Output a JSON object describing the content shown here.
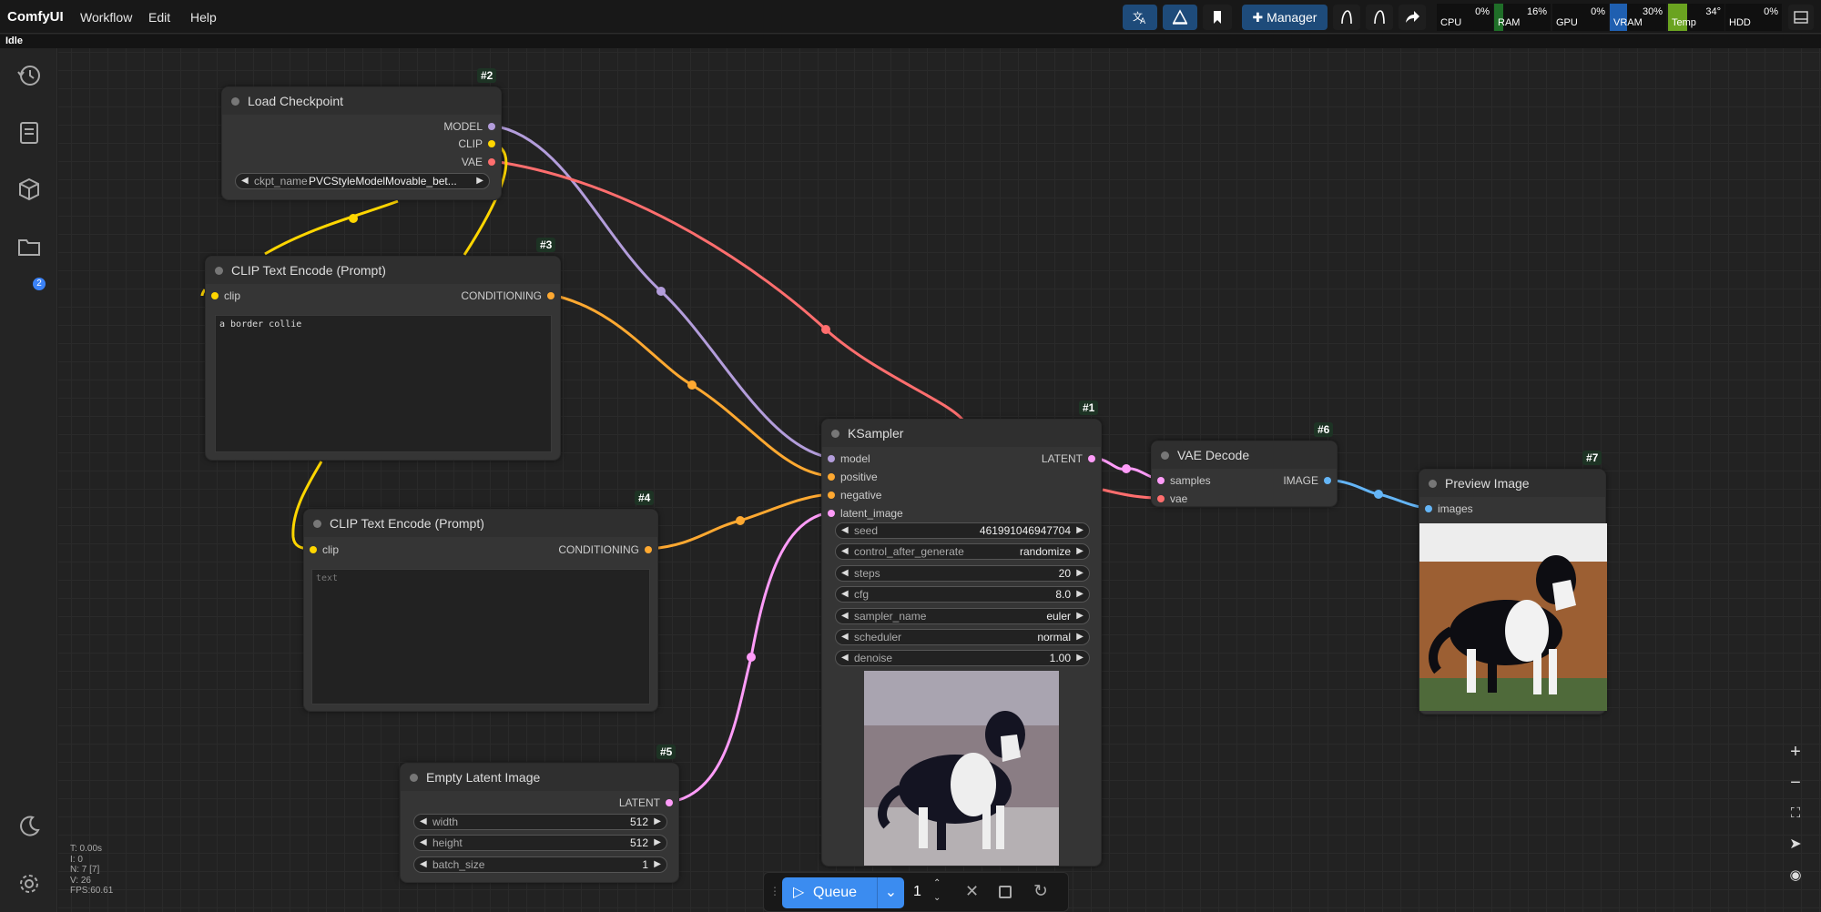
{
  "app": {
    "brand": "ComfyUI",
    "status": "Idle"
  },
  "menu": [
    "Workflow",
    "Edit",
    "Help"
  ],
  "toolbar": {
    "manager_label": "Manager"
  },
  "monitors": [
    {
      "label": "CPU",
      "value": "0%",
      "fill": 0.0,
      "color": "#2f7d32"
    },
    {
      "label": "RAM",
      "value": "16%",
      "fill": 0.16,
      "color": "#1f6e28"
    },
    {
      "label": "GPU",
      "value": "0%",
      "fill": 0.0,
      "color": "#2f7d32"
    },
    {
      "label": "VRAM",
      "value": "30%",
      "fill": 0.3,
      "color": "#1f5fb0"
    },
    {
      "label": "Temp",
      "value": "34°",
      "fill": 0.34,
      "color": "#6aa320"
    },
    {
      "label": "HDD",
      "value": "0%",
      "fill": 0.0,
      "color": "#2f7d32"
    }
  ],
  "sidebar": {
    "queue_badge": "2"
  },
  "nodes": {
    "load_checkpoint": {
      "id": "#2",
      "title": "Load Checkpoint",
      "outputs": [
        "MODEL",
        "CLIP",
        "VAE"
      ],
      "ckpt_label": "ckpt_name",
      "ckpt_value": "PVCStyleModelMovable_bet..."
    },
    "clip_pos": {
      "id": "#3",
      "title": "CLIP Text Encode (Prompt)",
      "input": "clip",
      "output": "CONDITIONING",
      "text": "a border collie"
    },
    "clip_neg": {
      "id": "#4",
      "title": "CLIP Text Encode (Prompt)",
      "input": "clip",
      "output": "CONDITIONING",
      "placeholder": "text"
    },
    "empty_latent": {
      "id": "#5",
      "title": "Empty Latent Image",
      "output": "LATENT",
      "widgets": [
        {
          "label": "width",
          "value": "512"
        },
        {
          "label": "height",
          "value": "512"
        },
        {
          "label": "batch_size",
          "value": "1"
        }
      ]
    },
    "ksampler": {
      "id": "#1",
      "title": "KSampler",
      "inputs": [
        "model",
        "positive",
        "negative",
        "latent_image"
      ],
      "output": "LATENT",
      "widgets": [
        {
          "label": "seed",
          "value": "461991046947704"
        },
        {
          "label": "control_after_generate",
          "value": "randomize"
        },
        {
          "label": "steps",
          "value": "20"
        },
        {
          "label": "cfg",
          "value": "8.0"
        },
        {
          "label": "sampler_name",
          "value": "euler"
        },
        {
          "label": "scheduler",
          "value": "normal"
        },
        {
          "label": "denoise",
          "value": "1.00"
        }
      ]
    },
    "vae_decode": {
      "id": "#6",
      "title": "VAE Decode",
      "inputs": [
        "samples",
        "vae"
      ],
      "output": "IMAGE"
    },
    "preview": {
      "id": "#7",
      "title": "Preview Image",
      "input": "images"
    }
  },
  "queue": {
    "label": "Queue",
    "count": "1"
  },
  "stats": [
    "T: 0.00s",
    "I: 0",
    "N: 7 [7]",
    "V: 26",
    "FPS:60.61"
  ],
  "colors": {
    "model": "#b39ddb",
    "clip": "#ffd600",
    "vae": "#ff6e6e",
    "conditioning": "#ffa931",
    "latent": "#ff9cf9",
    "image": "#64b5f6",
    "accent": "#3b8cf0"
  }
}
